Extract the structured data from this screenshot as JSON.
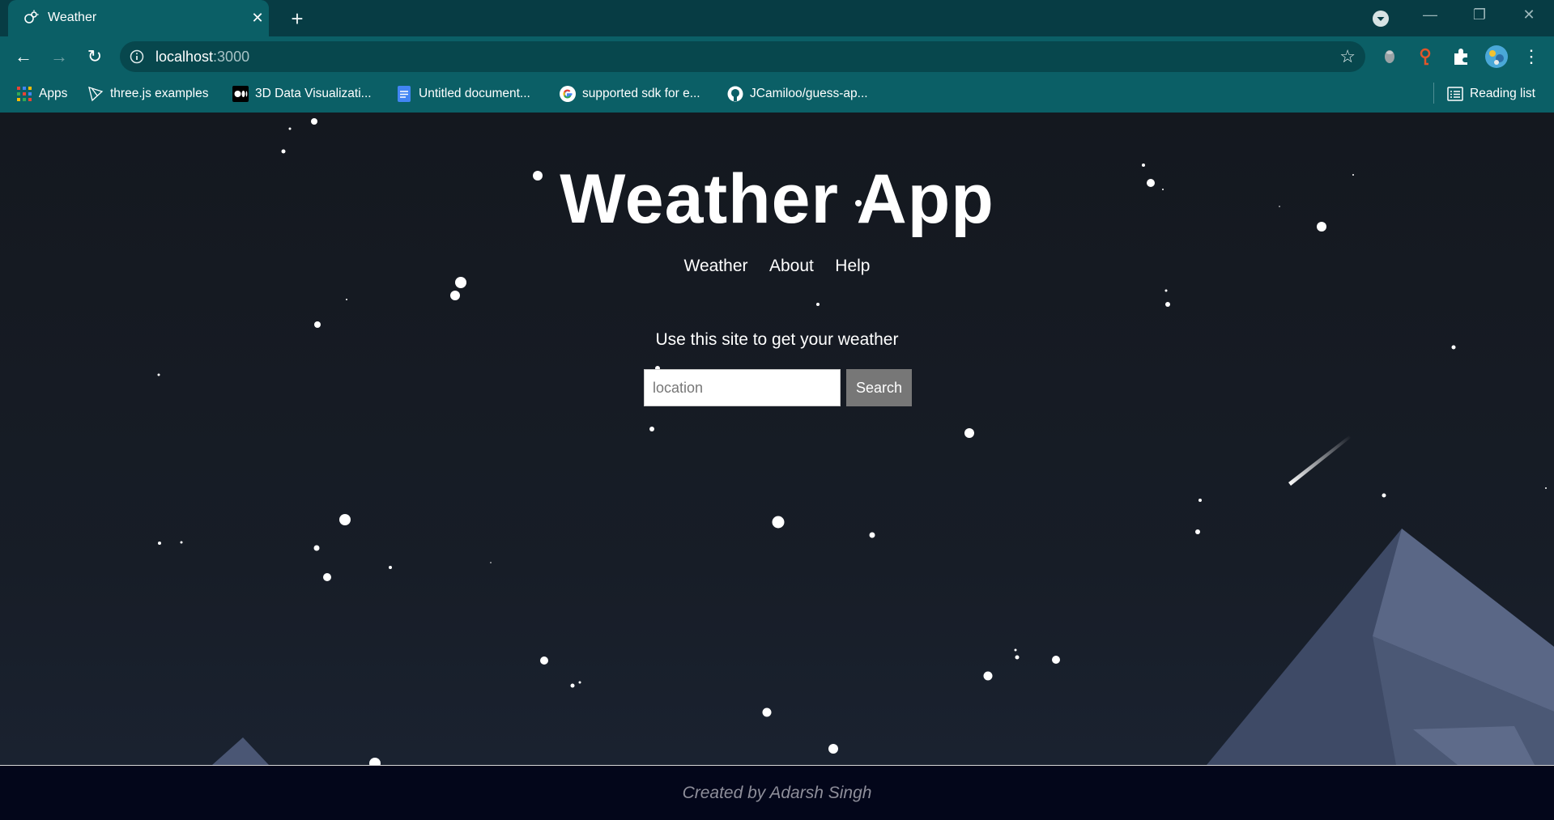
{
  "browser": {
    "tab_title": "Weather",
    "tab_close": "✕",
    "new_tab": "+",
    "window_controls": [
      "—",
      "❐",
      "✕"
    ],
    "url_host": "localhost",
    "url_port": ":3000",
    "bookmark_icon": "star-icon",
    "bookmarks": [
      {
        "label": "Apps",
        "icon": "apps-grid-icon"
      },
      {
        "label": "three.js examples",
        "icon": "threejs-icon"
      },
      {
        "label": "3D Data Visualizati...",
        "icon": "medium-icon"
      },
      {
        "label": "Untitled document...",
        "icon": "docs-icon"
      },
      {
        "label": "supported sdk for e...",
        "icon": "google-icon"
      },
      {
        "label": "JCamiloo/guess-ap...",
        "icon": "github-icon"
      }
    ],
    "reading_list": "Reading list"
  },
  "page": {
    "title": "Weather App",
    "nav": [
      "Weather",
      "About",
      "Help"
    ],
    "subtitle": "Use this site to get your weather",
    "search": {
      "placeholder": "location",
      "value": "",
      "button_label": "Search"
    },
    "footer": "Created by Adarsh Singh"
  },
  "colors": {
    "tab_bar": "#073c44",
    "toolbar": "#0b5f66",
    "page_background": "#151a24",
    "search_button": "#777777",
    "footer_background": "#03061a",
    "mountain": "#4a5674"
  }
}
